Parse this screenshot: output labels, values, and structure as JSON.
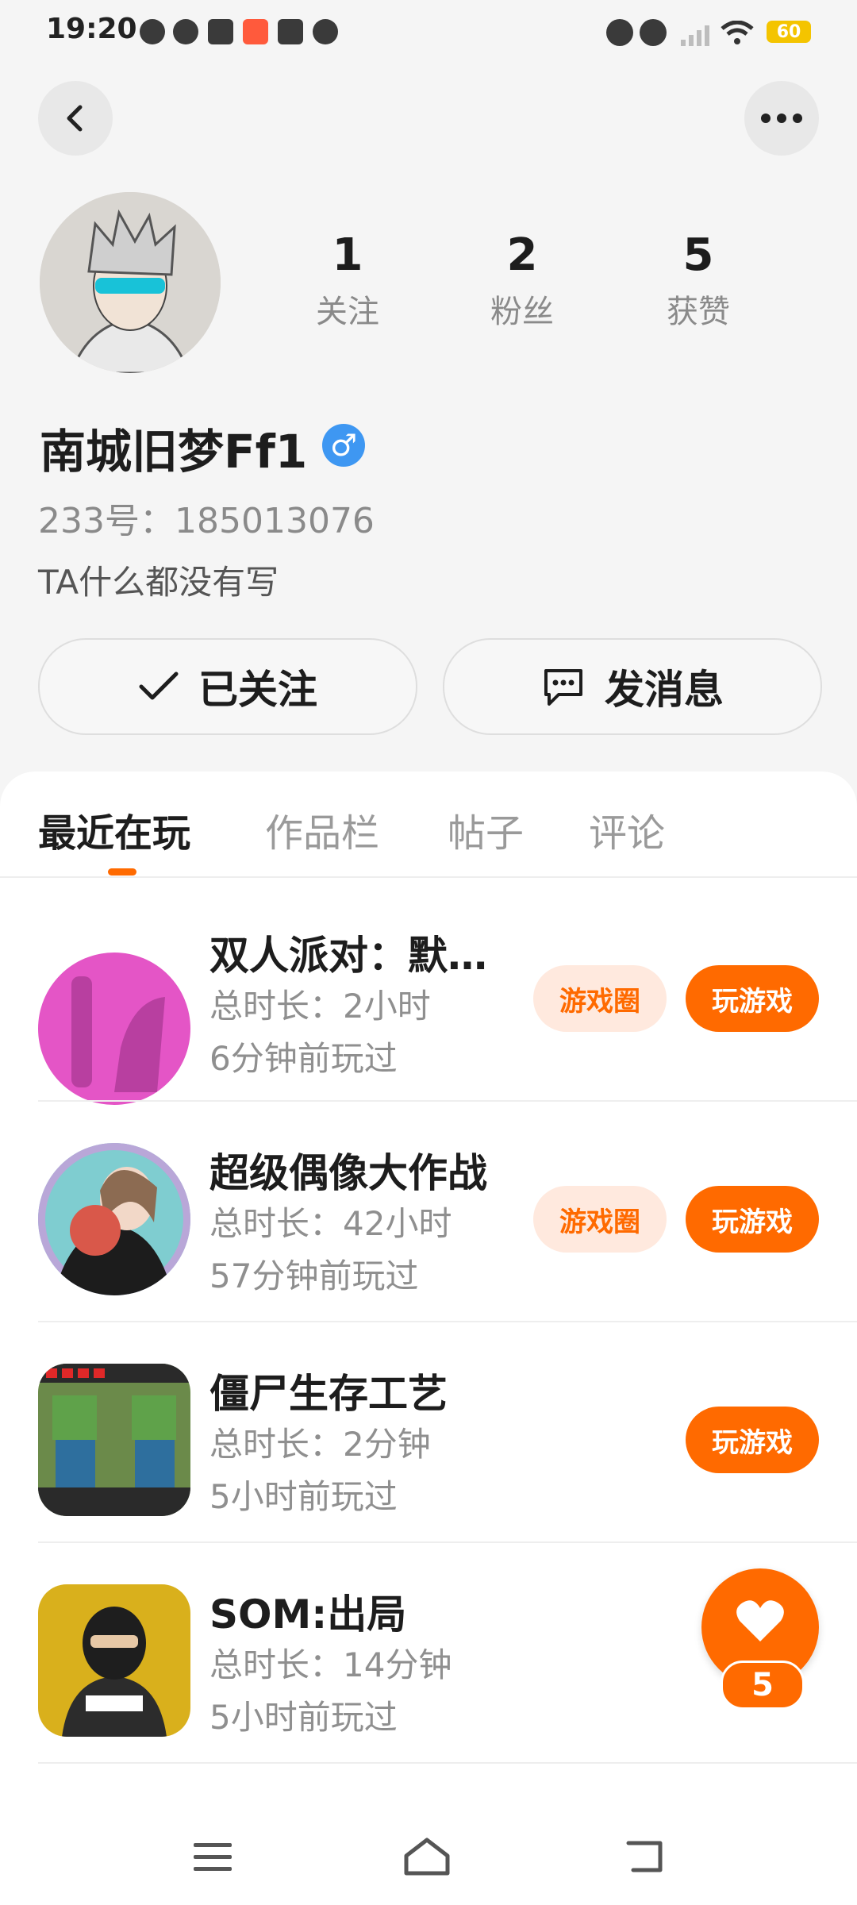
{
  "status_bar": {
    "time": "19:20",
    "battery": "60",
    "left_icons": [
      "cat-face-icon",
      "gauge-icon",
      "mail-icon",
      "app-icon",
      "music-icon",
      "robot-icon"
    ],
    "right_icons": [
      "alarm-icon",
      "mute-icon",
      "signal-icon",
      "wifi-icon",
      "battery-icon"
    ]
  },
  "header": {
    "back_icon": "chevron-left-icon",
    "more_icon": "more-dots-icon"
  },
  "profile": {
    "stats": [
      {
        "value": "1",
        "label": "关注"
      },
      {
        "value": "2",
        "label": "粉丝"
      },
      {
        "value": "5",
        "label": "获赞"
      }
    ],
    "username": "南城旧梦Ff1",
    "gender_symbol": "♂",
    "uid": "233号：185013076",
    "bio": "TA什么都没有写"
  },
  "actions": {
    "follow_label": "已关注",
    "message_label": "发消息"
  },
  "tabs": [
    {
      "label": "最近在玩"
    },
    {
      "label": "作品栏"
    },
    {
      "label": "帖子"
    },
    {
      "label": "评论"
    }
  ],
  "games": [
    {
      "title": "双人派对：默…",
      "duration": "总时长：2小时",
      "last_played": "6分钟前玩过",
      "circle_label": "游戏圈",
      "play_label": "玩游戏"
    },
    {
      "title": "超级偶像大作战",
      "duration": "总时长：42小时",
      "last_played": "57分钟前玩过",
      "circle_label": "游戏圈",
      "play_label": "玩游戏"
    },
    {
      "title": "僵尸生存工艺",
      "duration": "总时长：2分钟",
      "last_played": "5小时前玩过",
      "play_label": "玩游戏"
    },
    {
      "title": "SOM:出局",
      "duration": "总时长：14分钟",
      "last_played": "5小时前玩过"
    }
  ],
  "fab": {
    "like_count": "5"
  },
  "colors": {
    "accent": "#ff6a00",
    "gender_blue": "#3e97f2"
  }
}
